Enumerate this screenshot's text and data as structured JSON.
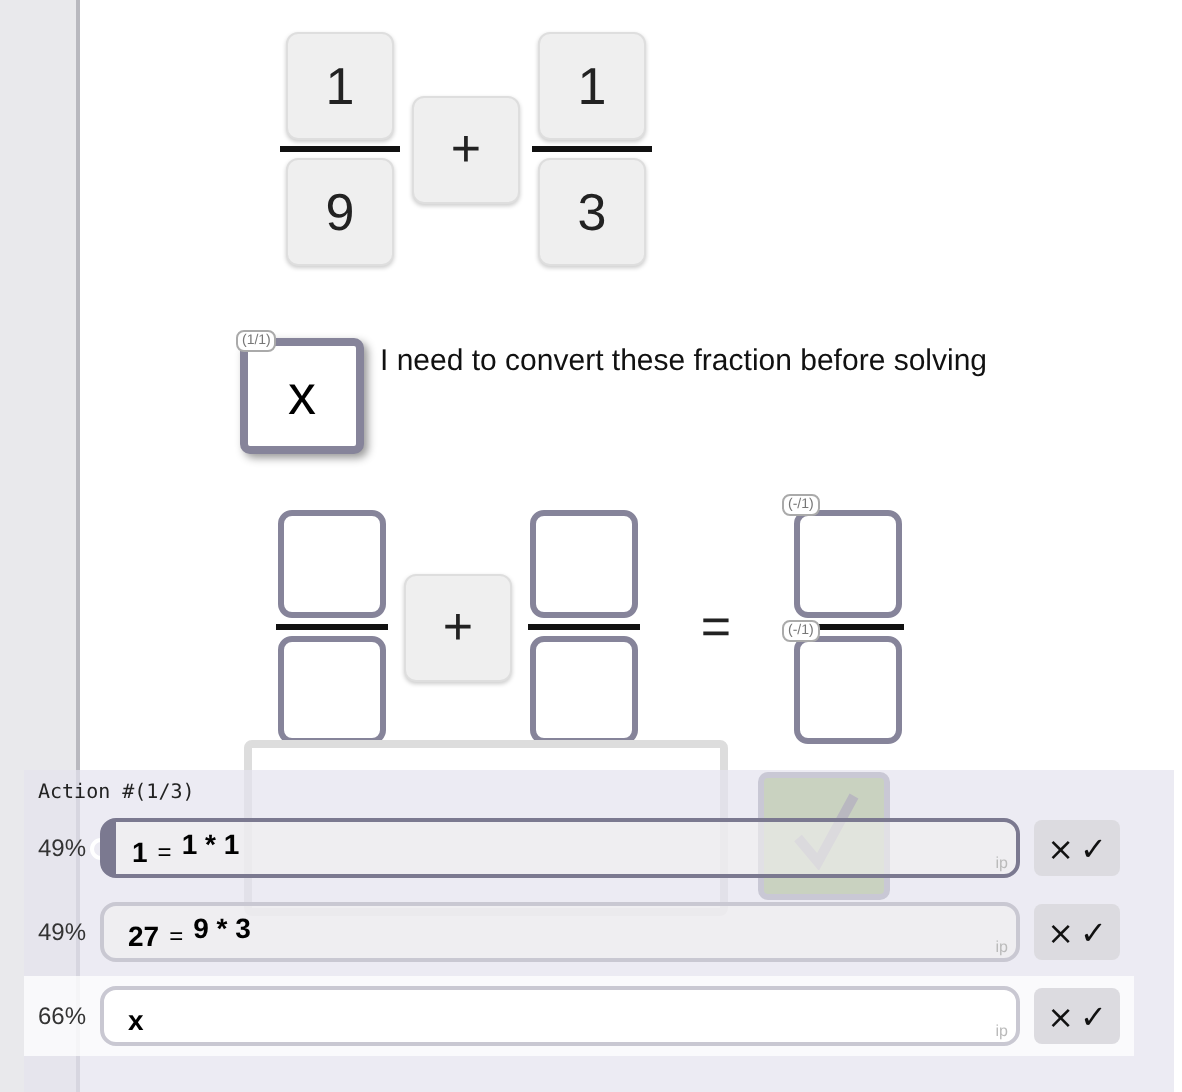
{
  "problem": {
    "left": {
      "numerator": "1",
      "denominator": "9"
    },
    "operator": "+",
    "right": {
      "numerator": "1",
      "denominator": "3"
    }
  },
  "note": {
    "tile": {
      "value": "x",
      "badge": "(1/1)"
    },
    "text": "I need to convert these fraction before solving"
  },
  "work": {
    "operator": "+",
    "equals": "=",
    "result_badges": [
      "(-/1)",
      "(-/1)"
    ]
  },
  "action_panel": {
    "title": "Action #(1/3)",
    "rows": [
      {
        "confidence": "49%",
        "lhs": "1",
        "equals": "=",
        "rhs": "1 * 1",
        "tag": "ip",
        "selected": true,
        "hovered": false,
        "reject": "×",
        "accept": "✓"
      },
      {
        "confidence": "49%",
        "lhs": "27",
        "equals": "=",
        "rhs": "9 * 3",
        "tag": "ip",
        "selected": false,
        "hovered": false,
        "reject": "×",
        "accept": "✓"
      },
      {
        "confidence": "66%",
        "lhs": "x",
        "tag": "ip",
        "selected": false,
        "hovered": true,
        "reject": "×",
        "accept": "✓"
      }
    ]
  }
}
